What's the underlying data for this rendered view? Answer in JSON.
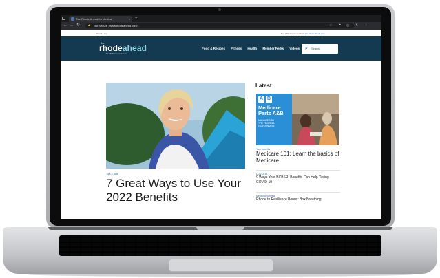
{
  "browser": {
    "tab_title": "The Rhode Ahead for Medica",
    "tab_close": "×",
    "new_tab": "+",
    "back": "←",
    "forward": "→",
    "reload": "↻",
    "security_label": "Not Secure",
    "url_domain": "www.rhodeahead.com",
    "url_path": "/...",
    "warn_icon": "warning-icon",
    "toolbar_icons": [
      "☆",
      "⚑",
      "◎",
      "↯",
      "⋯"
    ]
  },
  "utility_bar": {
    "left_text": "Select Lang",
    "right_text": "Not a Medicare member? ",
    "right_link": "Visit rhodeahead.com"
  },
  "site_header": {
    "logo_the": "the",
    "logo_name_1": "rhode",
    "logo_name_2": "ahead",
    "logo_sub": "for Medicare members",
    "nav": [
      "Food & Recipes",
      "Fitness",
      "Health",
      "Member Perks",
      "Videos"
    ],
    "search_placeholder": "Search",
    "search_icon": "search-icon"
  },
  "feature": {
    "kicker": "Tips & tools",
    "headline": "7 Great Ways to Use Your 2022 Benefits"
  },
  "latest": {
    "heading": "Latest",
    "thumb": {
      "badge_a": "A",
      "badge_b": "B",
      "title_1": "Medicare",
      "title_2": "Parts A&B",
      "managed_1": "MANAGED BY",
      "managed_2": "THE FEDERAL",
      "managed_3": "GOVERNMENT"
    },
    "items": [
      {
        "kicker": "Your benefits",
        "title": "Medicare 101: Learn the basics of Medicare"
      },
      {
        "kicker": "COVID-19",
        "title": "9 Ways Your BCBSRI Benefits Can Help During COVID-19"
      },
      {
        "kicker": "Mental well-being",
        "title": "Rhode to Resilience Bonus: Box Breathing"
      }
    ]
  },
  "colors": {
    "header_bg": "#133a50",
    "link_blue": "#2f6db3",
    "thumb_blue": "#2a8fd6"
  }
}
